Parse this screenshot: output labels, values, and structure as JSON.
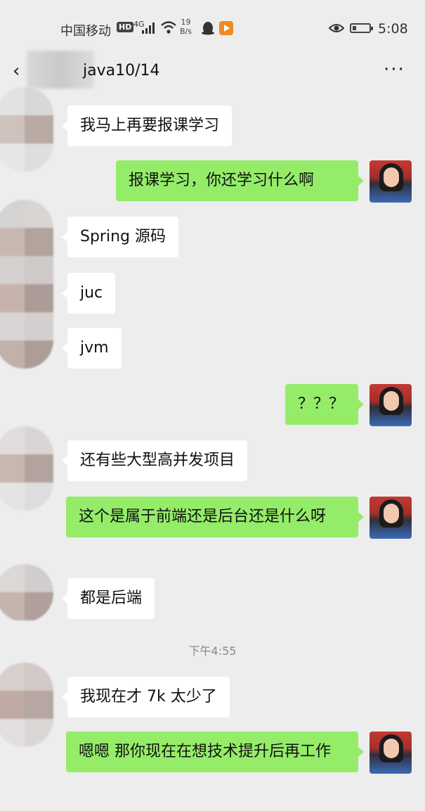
{
  "status_bar": {
    "carrier": "中国移动",
    "hd": "HD",
    "network": "4G",
    "speed_value": "19",
    "speed_unit": "B/s",
    "time": "5:08",
    "icons": [
      "signal-icon",
      "wifi-icon",
      "qq-penguin-icon",
      "video-app-icon",
      "eye-icon",
      "battery-icon"
    ]
  },
  "nav": {
    "back": "‹",
    "title": "java10/14",
    "more": "···"
  },
  "messages": [
    {
      "side": "in",
      "text": "我马上再要报课学习"
    },
    {
      "side": "out",
      "text": "报课学习，你还学习什么啊"
    },
    {
      "side": "in",
      "text": "Spring 源码"
    },
    {
      "side": "in",
      "text": "juc"
    },
    {
      "side": "in",
      "text": "jvm"
    },
    {
      "side": "out",
      "text": "？？？"
    },
    {
      "side": "in",
      "text": "还有些大型高并发项目"
    },
    {
      "side": "out",
      "text": "这个是属于前端还是后台还是什么呀"
    },
    {
      "side": "in",
      "text": "都是后端"
    },
    {
      "side": "in",
      "text": "我现在才 7k 太少了"
    },
    {
      "side": "out",
      "text": "嗯嗯 那你现在在想技术提升后再工作"
    }
  ],
  "timestamp": "下午4:55",
  "colors": {
    "background": "#ededed",
    "incoming_bubble": "#ffffff",
    "outgoing_bubble": "#95ec69"
  }
}
